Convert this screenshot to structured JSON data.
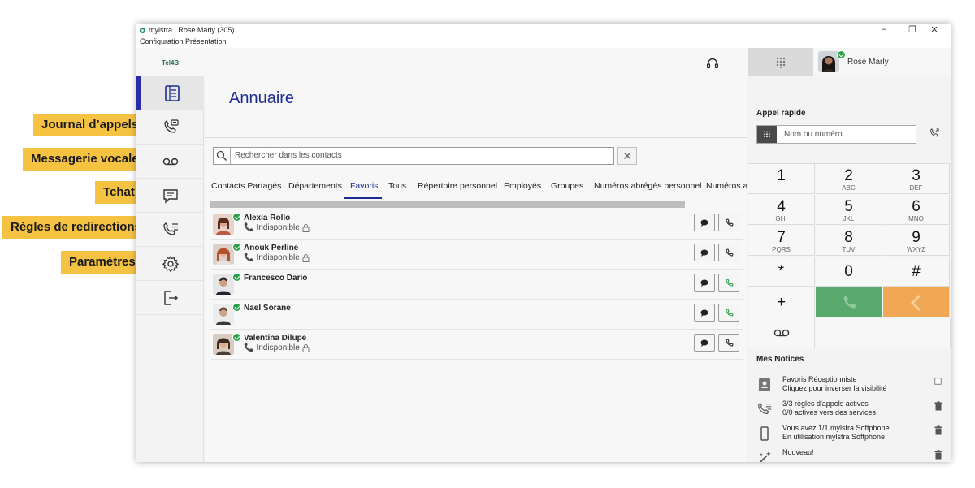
{
  "callouts": {
    "journal": "Journal d’appels",
    "messagerie": "Messagerie vocale",
    "tchat": "Tchat",
    "regles": "Règles de redirections",
    "parametres": "Paramètres"
  },
  "window": {
    "title": "mylstra | Rose Marly (305)",
    "menu": [
      "Configuration",
      "Présentation"
    ],
    "logo": "Tel4B"
  },
  "directory": {
    "title": "Annuaire",
    "search_placeholder": "Rechercher dans les contacts",
    "tabs": [
      "Contacts Partagés",
      "Départements",
      "Favoris",
      "Tous",
      "Répertoire personnel",
      "Employés",
      "Groupes",
      "Numéros abrégés personnel",
      "Numéros ab"
    ],
    "active_tab": "Favoris",
    "contacts": [
      {
        "name": "Alexia Rollo",
        "status": "Indisponible"
      },
      {
        "name": "Anouk Perline",
        "status": "Indisponible"
      },
      {
        "name": "Francesco Dario",
        "status": ""
      },
      {
        "name": "Nael Sorane",
        "status": ""
      },
      {
        "name": "Valentina Dilupe",
        "status": "Indisponible"
      }
    ]
  },
  "user": {
    "name": "Rose Marly"
  },
  "quick_call": {
    "title": "Appel rapide",
    "placeholder": "Nom ou numéro"
  },
  "keypad": [
    {
      "d": "1",
      "l": ""
    },
    {
      "d": "2",
      "l": "ABC"
    },
    {
      "d": "3",
      "l": "DEF"
    },
    {
      "d": "4",
      "l": "GHI"
    },
    {
      "d": "5",
      "l": "JKL"
    },
    {
      "d": "6",
      "l": "MNO"
    },
    {
      "d": "7",
      "l": "PQRS"
    },
    {
      "d": "8",
      "l": "TUV"
    },
    {
      "d": "9",
      "l": "WXYZ"
    },
    {
      "d": "*",
      "l": ""
    },
    {
      "d": "0",
      "l": ""
    },
    {
      "d": "#",
      "l": ""
    },
    {
      "d": "+",
      "l": ""
    }
  ],
  "notices": {
    "title": "Mes Notices",
    "items": [
      {
        "line1": "Favoris Réceptionniste",
        "line2": "Cliquez pour inverser la visibilité",
        "icon": "contact-card-icon",
        "action": "checkbox-icon"
      },
      {
        "line1": "3/3 règles d'appels actives",
        "line2": "0/0 actives vers des services",
        "icon": "redirect-rules-icon",
        "action": "trash-icon"
      },
      {
        "line1": "Vous avez 1/1 mylstra Softphone",
        "line2": "En utilisation mylstra Softphone",
        "icon": "mobile-phone-icon",
        "action": "trash-icon"
      },
      {
        "line1": "Nouveau!",
        "line2": "",
        "icon": "magic-wand-icon",
        "action": "trash-icon"
      }
    ]
  },
  "colors": {
    "accent": "#1b2b8f",
    "call": "#5aaa70",
    "back": "#f0a854",
    "callout": "#f5c242",
    "online": "#2aa148"
  }
}
